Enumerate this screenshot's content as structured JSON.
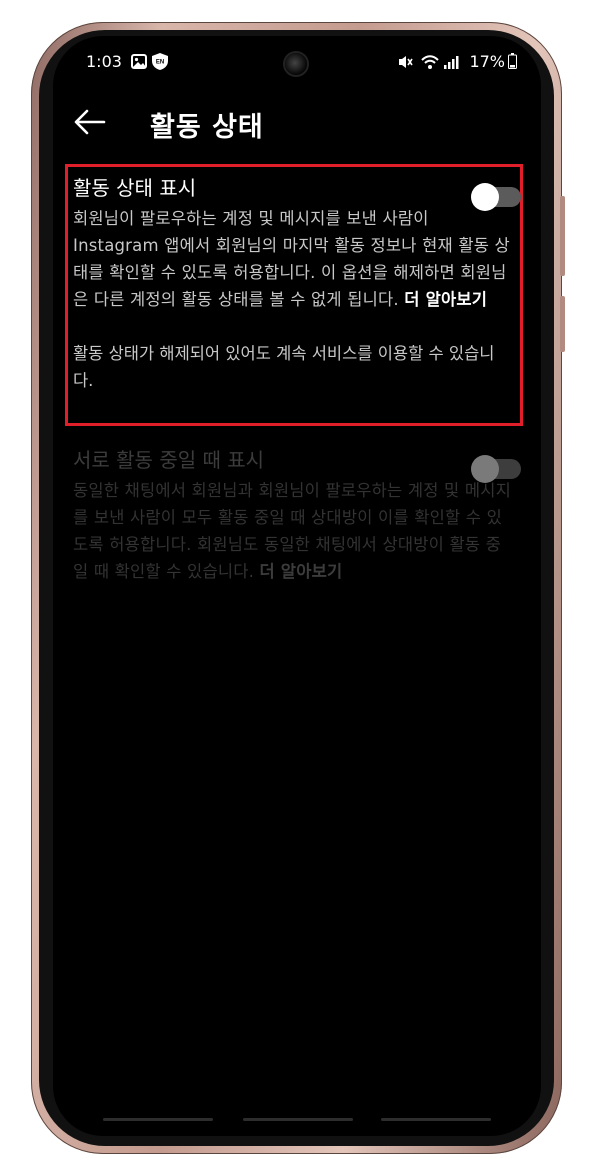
{
  "status_bar": {
    "time": "1:03",
    "battery": "17%",
    "icons": [
      "image-icon",
      "shield-icon",
      "mute-icon",
      "wifi-icon",
      "signal-icon",
      "battery-icon"
    ]
  },
  "header": {
    "title": "활동 상태",
    "back_icon": "arrow-left-icon"
  },
  "settings": [
    {
      "title": "활동 상태 표시",
      "description": "회원님이 팔로우하는 계정 및 메시지를 보낸 사람이 Instagram 앱에서 회원님의 마지막 활동 정보나 현재 활동 상태를 확인할 수 있도록 허용합니다. 이 옵션을 해제하면 회원님은 다른 계정의 활동 상태를 볼 수 없게 됩니다.",
      "learn_more": "더 알아보기",
      "note": "활동 상태가 해제되어 있어도 계속 서비스를 이용할 수 있습니다.",
      "enabled": false
    },
    {
      "title": "서로 활동 중일 때 표시",
      "description": "동일한 채팅에서 회원님과 회원님이 팔로우하는 계정 및 메시지를 보낸 사람이 모두 활동 중일 때 상대방이 이를 확인할 수 있도록 허용합니다. 회원님도 동일한 채팅에서 상대방이 활동 중일 때 확인할 수 있습니다.",
      "learn_more": "더 알아보기",
      "enabled": false
    }
  ],
  "colors": {
    "highlight": "#e01f2b",
    "background": "#000000",
    "frame": "#c49b8f"
  }
}
